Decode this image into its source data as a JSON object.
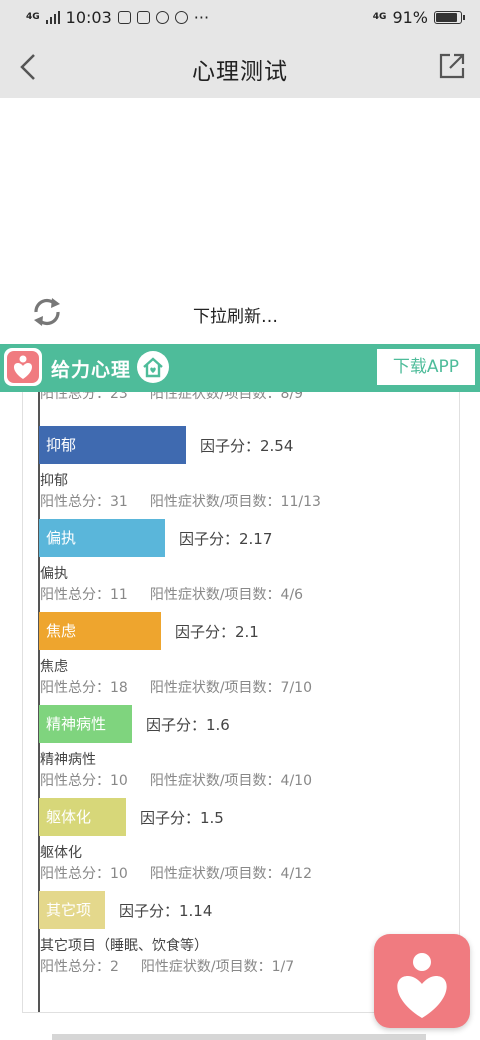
{
  "status_bar": {
    "network": "4G",
    "time": "10:03",
    "signal_4g": "4G",
    "battery": "91%"
  },
  "nav": {
    "title": "心理测试"
  },
  "refresh": {
    "text": "下拉刷新…"
  },
  "banner": {
    "title": "给力心理",
    "download_label": "下载APP",
    "accent": "#4ebc9a"
  },
  "report": {
    "partial_row": {
      "total": "阳性总分：23",
      "ratio": "阳性症状数/项目数：8/9"
    },
    "factors": [
      {
        "label": "抑郁",
        "score": "因子分：2.54",
        "name": "抑郁",
        "total": "阳性总分：31",
        "ratio": "阳性症状数/项目数：11/13",
        "color": "#3f6ab0",
        "value": 2.54
      },
      {
        "label": "偏执",
        "score": "因子分：2.17",
        "name": "偏执",
        "total": "阳性总分：11",
        "ratio": "阳性症状数/项目数：4/6",
        "color": "#5ab6da",
        "value": 2.17
      },
      {
        "label": "焦虑",
        "score": "因子分：2.1",
        "name": "焦虑",
        "total": "阳性总分：18",
        "ratio": "阳性症状数/项目数：7/10",
        "color": "#eea52e",
        "value": 2.1
      },
      {
        "label": "精神病性",
        "score": "因子分：1.6",
        "name": "精神病性",
        "total": "阳性总分：10",
        "ratio": "阳性症状数/项目数：4/10",
        "color": "#7fd47e",
        "value": 1.6
      },
      {
        "label": "躯体化",
        "score": "因子分：1.5",
        "name": "躯体化",
        "total": "阳性总分：10",
        "ratio": "阳性症状数/项目数：4/12",
        "color": "#d7d779",
        "value": 1.5
      },
      {
        "label": "其它项",
        "score": "因子分：1.14",
        "name": "其它项目（睡眠、饮食等）",
        "total": "阳性总分：2",
        "ratio": "阳性症状数/项目数：1/7",
        "color": "#e4d88c",
        "value": 1.14
      }
    ]
  },
  "colors": {
    "fab": "#f07b80"
  }
}
